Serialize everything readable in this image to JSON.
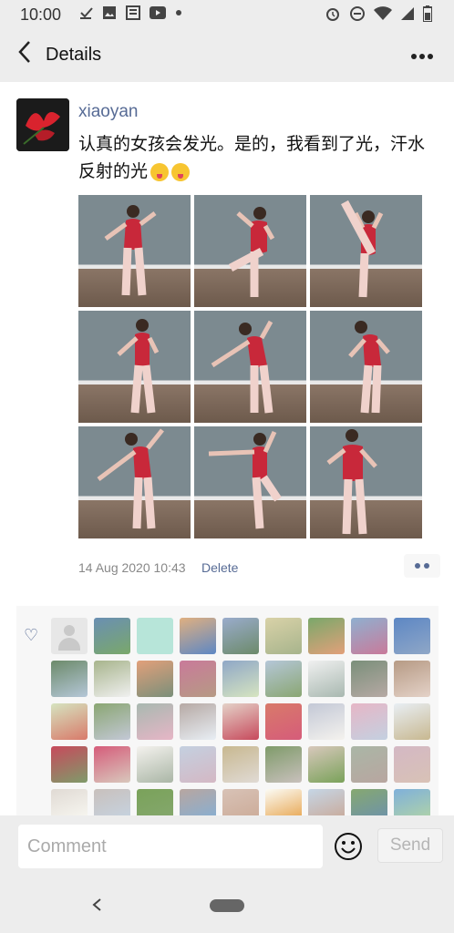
{
  "status_bar": {
    "time": "10:00",
    "left_icons": [
      "download-icon",
      "image-icon",
      "news-icon",
      "youtube-icon",
      "dot-icon"
    ],
    "right_icons": [
      "alarm-icon",
      "do-not-disturb-icon",
      "wifi-icon",
      "signal-icon",
      "battery-icon"
    ]
  },
  "header": {
    "title": "Details"
  },
  "post": {
    "username": "xiaoyan",
    "text": "认真的女孩会发光。是的，我看到了光，汗水反射的光",
    "emojis": [
      "tongue-wink-emoji",
      "tongue-wink-emoji"
    ],
    "photo_count": 9,
    "timestamp": "14 Aug 2020 10:43",
    "delete_label": "Delete"
  },
  "likes": {
    "count_rows": 5,
    "avatars": [
      "default",
      "portrait",
      "nice-sticker",
      "person",
      "skier",
      "cartoon-duck",
      "sunflowers",
      "field",
      "landscape",
      "garden",
      "man-field",
      "sunset",
      "pink-flowers",
      "city-skyline",
      "tree-winter",
      "cartoon-bat",
      "tree-house",
      "dog",
      "flowers-vase",
      "potted-plant",
      "river",
      "castle",
      "girl",
      "sunset-sky",
      "cherry-blossom",
      "kids",
      "snow",
      "rose",
      "red-flowers",
      "dog-white",
      "boy",
      "beach",
      "tree",
      "woman",
      "fish-bowl",
      "flowers",
      "girl-drawing",
      "couple",
      "green-field",
      "kids-group",
      "girl-hair",
      "text-sticker",
      "water",
      "trees",
      "ocean",
      "girl-smile",
      "orange"
    ]
  },
  "comment_bar": {
    "placeholder": "Comment",
    "send_label": "Send"
  },
  "colors": {
    "link": "#576b95",
    "background": "#ededed",
    "leotard": "#c8283a"
  }
}
